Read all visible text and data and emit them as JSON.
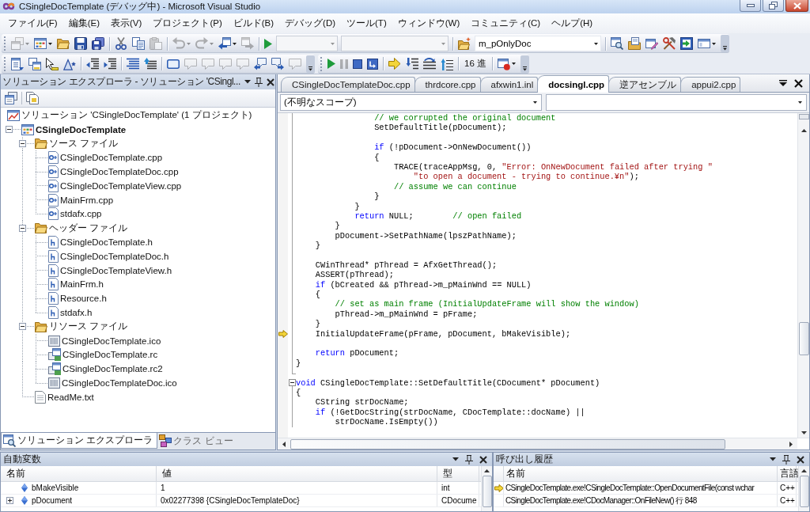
{
  "window": {
    "title": "CSingleDocTemplate (デバッグ中) - Microsoft Visual Studio"
  },
  "menu": [
    "ファイル(F)",
    "編集(E)",
    "表示(V)",
    "プロジェクト(P)",
    "ビルド(B)",
    "デバッグ(D)",
    "ツール(T)",
    "ウィンドウ(W)",
    "コミュニティ(C)",
    "ヘルプ(H)"
  ],
  "toolbar_rows": [
    {
      "toolbars": [
        {
          "items": [
            {
              "kind": "button",
              "disabled": true,
              "dropdown": true
            },
            {
              "kind": "button",
              "disabled": false,
              "dropdown": true
            },
            {
              "kind": "button",
              "disabled": false
            },
            {
              "kind": "button",
              "disabled": false
            },
            {
              "kind": "button",
              "disabled": false
            },
            {
              "kind": "separator"
            },
            {
              "kind": "button",
              "disabled": false
            },
            {
              "kind": "button",
              "disabled": false
            },
            {
              "kind": "button",
              "disabled": true
            },
            {
              "kind": "separator"
            },
            {
              "kind": "button",
              "disabled": true,
              "dropdown": true
            },
            {
              "kind": "button",
              "disabled": true,
              "dropdown": true
            },
            {
              "kind": "button",
              "disabled": false,
              "dropdown": true
            },
            {
              "kind": "button",
              "disabled": true
            },
            {
              "kind": "separator"
            },
            {
              "kind": "button",
              "disabled": false
            },
            {
              "kind": "combo",
              "disabled": true
            },
            {
              "kind": "combo",
              "disabled": true
            },
            {
              "kind": "separator"
            },
            {
              "kind": "button",
              "disabled": false
            },
            {
              "kind": "combo",
              "disabled": false,
              "value": "m_pOnlyDoc"
            },
            {
              "kind": "separator"
            },
            {
              "kind": "button",
              "disabled": false
            },
            {
              "kind": "button",
              "disabled": false
            },
            {
              "kind": "button",
              "disabled": false
            },
            {
              "kind": "button",
              "disabled": false
            },
            {
              "kind": "button",
              "disabled": false
            },
            {
              "kind": "button",
              "disabled": false,
              "dropdown": true
            }
          ]
        }
      ]
    },
    {
      "toolbars": [
        {
          "items": [
            {
              "kind": "button",
              "disabled": false
            },
            {
              "kind": "button",
              "disabled": false
            },
            {
              "kind": "button",
              "disabled": false
            },
            {
              "kind": "button",
              "disabled": false
            },
            {
              "kind": "separator"
            },
            {
              "kind": "button",
              "disabled": false
            },
            {
              "kind": "button",
              "disabled": false
            },
            {
              "kind": "separator"
            },
            {
              "kind": "button",
              "disabled": false
            },
            {
              "kind": "button",
              "disabled": false
            },
            {
              "kind": "separator"
            },
            {
              "kind": "button",
              "disabled": false
            },
            {
              "kind": "button",
              "disabled": true
            },
            {
              "kind": "button",
              "disabled": true
            },
            {
              "kind": "button",
              "disabled": true
            },
            {
              "kind": "button",
              "disabled": true
            },
            {
              "kind": "button",
              "disabled": false
            },
            {
              "kind": "button",
              "disabled": false
            },
            {
              "kind": "button",
              "disabled": true
            }
          ]
        },
        {
          "items": [
            {
              "kind": "button",
              "disabled": false
            },
            {
              "kind": "button",
              "disabled": true
            },
            {
              "kind": "button",
              "disabled": false
            },
            {
              "kind": "button",
              "disabled": false
            },
            {
              "kind": "separator"
            },
            {
              "kind": "button",
              "disabled": false
            },
            {
              "kind": "button",
              "disabled": false
            },
            {
              "kind": "button",
              "disabled": false
            },
            {
              "kind": "button",
              "disabled": false
            },
            {
              "kind": "separator"
            },
            {
              "kind": "text",
              "label": "16 進",
              "disabled": false
            },
            {
              "kind": "separator"
            },
            {
              "kind": "button",
              "disabled": false,
              "dropdown": true
            }
          ]
        }
      ]
    }
  ],
  "solution_explorer": {
    "title": "ソリューション エクスプローラ - ソリューション 'CSingl...",
    "tree": [
      {
        "label": "ソリューション 'CSingleDocTemplate' (1 プロジェクト)",
        "kind": "solution",
        "children": [
          {
            "label": "CSingleDocTemplate",
            "kind": "project",
            "expanded": true,
            "children": [
              {
                "label": "ソース ファイル",
                "kind": "folder",
                "expanded": true,
                "children": [
                  {
                    "label": "CSingleDocTemplate.cpp",
                    "kind": "source"
                  },
                  {
                    "label": "CSingleDocTemplateDoc.cpp",
                    "kind": "source"
                  },
                  {
                    "label": "CSingleDocTemplateView.cpp",
                    "kind": "source"
                  },
                  {
                    "label": "MainFrm.cpp",
                    "kind": "source"
                  },
                  {
                    "label": "stdafx.cpp",
                    "kind": "source"
                  }
                ]
              },
              {
                "label": "ヘッダー ファイル",
                "kind": "folder",
                "expanded": true,
                "children": [
                  {
                    "label": "CSingleDocTemplate.h",
                    "kind": "header"
                  },
                  {
                    "label": "CSingleDocTemplateDoc.h",
                    "kind": "header"
                  },
                  {
                    "label": "CSingleDocTemplateView.h",
                    "kind": "header"
                  },
                  {
                    "label": "MainFrm.h",
                    "kind": "header"
                  },
                  {
                    "label": "Resource.h",
                    "kind": "header"
                  },
                  {
                    "label": "stdafx.h",
                    "kind": "header"
                  }
                ]
              },
              {
                "label": "リソース ファイル",
                "kind": "folder",
                "expanded": true,
                "children": [
                  {
                    "label": "CSingleDocTemplate.ico",
                    "kind": "image"
                  },
                  {
                    "label": "CSingleDocTemplate.rc",
                    "kind": "resource"
                  },
                  {
                    "label": "CSingleDocTemplate.rc2",
                    "kind": "resource"
                  },
                  {
                    "label": "CSingleDocTemplateDoc.ico",
                    "kind": "image"
                  }
                ]
              },
              {
                "label": "ReadMe.txt",
                "kind": "text"
              }
            ]
          }
        ]
      }
    ],
    "tabs": [
      {
        "label": "ソリューション エクスプローラ",
        "selected": true
      },
      {
        "label": "クラス ビュー",
        "selected": false
      }
    ]
  },
  "editor": {
    "tabs": [
      {
        "label": "CSingleDocTemplateDoc.cpp",
        "selected": false
      },
      {
        "label": "thrdcore.cpp",
        "selected": false
      },
      {
        "label": "afxwin1.inl",
        "selected": false
      },
      {
        "label": "docsingl.cpp",
        "selected": true
      },
      {
        "label": "逆アセンブル",
        "selected": false
      },
      {
        "label": "appui2.cpp",
        "selected": false
      }
    ],
    "scope": "(不明なスコープ)",
    "lines": [
      {
        "kind": "code",
        "current": false,
        "fold": false,
        "tokens": [
          {
            "kind": "comment",
            "text": "                // we corrupted the original document"
          }
        ]
      },
      {
        "kind": "code",
        "current": false,
        "fold": false,
        "tokens": [
          {
            "kind": "plain",
            "text": "                SetDefaultTitle(pDocument);"
          }
        ]
      },
      {
        "kind": "blank"
      },
      {
        "kind": "code",
        "current": false,
        "fold": false,
        "tokens": [
          {
            "kind": "keyword",
            "text": "                if"
          },
          {
            "kind": "plain",
            "text": " (!pDocument->OnNewDocument())"
          }
        ]
      },
      {
        "kind": "code",
        "current": false,
        "fold": false,
        "tokens": [
          {
            "kind": "plain",
            "text": "                {"
          }
        ]
      },
      {
        "kind": "code",
        "current": false,
        "fold": false,
        "tokens": [
          {
            "kind": "plain",
            "text": "                    TRACE(traceAppMsg, 0, "
          },
          {
            "kind": "string",
            "text": "\"Error: OnNewDocument failed after trying \""
          }
        ]
      },
      {
        "kind": "code",
        "current": false,
        "fold": false,
        "tokens": [
          {
            "kind": "string",
            "text": "                        \"to open a document - trying to continue.¥n\""
          },
          {
            "kind": "plain",
            "text": ");"
          }
        ]
      },
      {
        "kind": "code",
        "current": false,
        "fold": false,
        "tokens": [
          {
            "kind": "comment",
            "text": "                    // assume we can continue"
          }
        ]
      },
      {
        "kind": "code",
        "current": false,
        "fold": false,
        "tokens": [
          {
            "kind": "plain",
            "text": "                }"
          }
        ]
      },
      {
        "kind": "code",
        "current": false,
        "fold": false,
        "tokens": [
          {
            "kind": "plain",
            "text": "            }"
          }
        ]
      },
      {
        "kind": "code",
        "current": false,
        "fold": false,
        "tokens": [
          {
            "kind": "keyword",
            "text": "            return"
          },
          {
            "kind": "plain",
            "text": " NULL;        "
          },
          {
            "kind": "comment",
            "text": "// open failed"
          }
        ]
      },
      {
        "kind": "code",
        "current": false,
        "fold": false,
        "tokens": [
          {
            "kind": "plain",
            "text": "        }"
          }
        ]
      },
      {
        "kind": "code",
        "current": false,
        "fold": false,
        "tokens": [
          {
            "kind": "plain",
            "text": "        pDocument->SetPathName(lpszPathName);"
          }
        ]
      },
      {
        "kind": "code",
        "current": false,
        "fold": false,
        "tokens": [
          {
            "kind": "plain",
            "text": "    }"
          }
        ]
      },
      {
        "kind": "blank"
      },
      {
        "kind": "code",
        "current": false,
        "fold": false,
        "tokens": [
          {
            "kind": "plain",
            "text": "    CWinThread* pThread = AfxGetThread();"
          }
        ]
      },
      {
        "kind": "code",
        "current": false,
        "fold": false,
        "tokens": [
          {
            "kind": "plain",
            "text": "    ASSERT(pThread);"
          }
        ]
      },
      {
        "kind": "code",
        "current": false,
        "fold": false,
        "tokens": [
          {
            "kind": "keyword",
            "text": "    if"
          },
          {
            "kind": "plain",
            "text": " (bCreated && pThread->m_pMainWnd == NULL)"
          }
        ]
      },
      {
        "kind": "code",
        "current": false,
        "fold": false,
        "tokens": [
          {
            "kind": "plain",
            "text": "    {"
          }
        ]
      },
      {
        "kind": "code",
        "current": false,
        "fold": false,
        "tokens": [
          {
            "kind": "comment",
            "text": "        // set as main frame (InitialUpdateFrame will show the window)"
          }
        ]
      },
      {
        "kind": "code",
        "current": false,
        "fold": false,
        "tokens": [
          {
            "kind": "plain",
            "text": "        pThread->m_pMainWnd = pFrame;"
          }
        ]
      },
      {
        "kind": "code",
        "current": false,
        "fold": false,
        "tokens": [
          {
            "kind": "plain",
            "text": "    }"
          }
        ]
      },
      {
        "kind": "code",
        "current": true,
        "fold": false,
        "tokens": [
          {
            "kind": "plain",
            "text": "    InitialUpdateFrame(pFrame, pDocument, bMakeVisible);"
          }
        ]
      },
      {
        "kind": "blank"
      },
      {
        "kind": "code",
        "current": false,
        "fold": false,
        "tokens": [
          {
            "kind": "keyword",
            "text": "    return"
          },
          {
            "kind": "plain",
            "text": " pDocument;"
          }
        ]
      },
      {
        "kind": "code",
        "current": false,
        "fold": false,
        "tokens": [
          {
            "kind": "plain",
            "text": "}"
          }
        ]
      },
      {
        "kind": "blank"
      },
      {
        "kind": "code",
        "current": false,
        "fold": true,
        "tokens": [
          {
            "kind": "keyword",
            "text": "void"
          },
          {
            "kind": "plain",
            "text": " CSingleDocTemplate::SetDefaultTitle(CDocument* pDocument)"
          }
        ]
      },
      {
        "kind": "code",
        "current": false,
        "fold": false,
        "tokens": [
          {
            "kind": "plain",
            "text": "{"
          }
        ]
      },
      {
        "kind": "code",
        "current": false,
        "fold": false,
        "tokens": [
          {
            "kind": "plain",
            "text": "    CString strDocName;"
          }
        ]
      },
      {
        "kind": "code",
        "current": false,
        "fold": false,
        "tokens": [
          {
            "kind": "keyword",
            "text": "    if"
          },
          {
            "kind": "plain",
            "text": " (!GetDocString(strDocName, CDocTemplate::docName) ||"
          }
        ]
      },
      {
        "kind": "code",
        "current": false,
        "fold": false,
        "tokens": [
          {
            "kind": "plain",
            "text": "        strDocName.IsEmpty())"
          }
        ]
      }
    ]
  },
  "autos": {
    "title": "自動変数",
    "columns": [
      "名前",
      "値",
      "型"
    ],
    "rows": [
      {
        "kind": "value",
        "name": "bMakeVisible",
        "value": "1",
        "type": "int"
      },
      {
        "kind": "object",
        "expanded": false,
        "name": "pDocument",
        "value": "0x02277398 {CSingleDocTemplateDoc}",
        "type": "CDocume"
      }
    ]
  },
  "call_stack": {
    "title": "呼び出し履歴",
    "columns": [
      "名前",
      "言語"
    ],
    "rows": [
      {
        "current": true,
        "name": "CSingleDocTemplate.exe!CSingleDocTemplate::OpenDocumentFile(const wchar",
        "language": "C++"
      },
      {
        "current": false,
        "name": "CSingleDocTemplate.exe!CDocManager::OnFileNew() 行 848",
        "language": "C++"
      }
    ]
  }
}
